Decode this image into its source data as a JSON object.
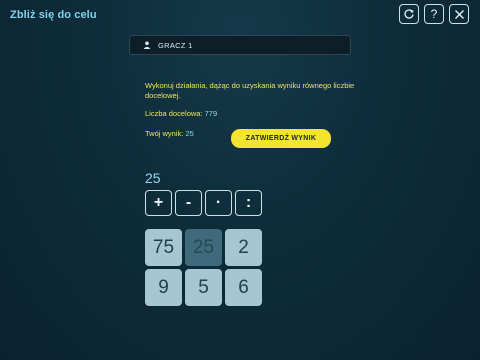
{
  "header": {
    "title": "Zbliż się do celu"
  },
  "toolbar": {
    "buttons": [
      {
        "icon": "refresh-icon"
      },
      {
        "label": "?",
        "icon": "help-icon"
      },
      {
        "icon": "close-icon"
      }
    ]
  },
  "player": {
    "name": "GRACZ 1",
    "icon": "user-icon"
  },
  "instructions": "Wykonuj działania, dążąc do uzyskania wyniku równego liczbie docelowej.",
  "target": {
    "label": "Liczba docelowa:",
    "value": "779"
  },
  "score": {
    "label": "Twój wynik:",
    "value": "25"
  },
  "submit_label": "ZATWIERDŹ WYNIK",
  "current_value": "25",
  "operators": [
    "+",
    "-",
    "·",
    ":"
  ],
  "numbers": [
    {
      "value": "75",
      "used": false
    },
    {
      "value": "25",
      "used": true
    },
    {
      "value": "2",
      "used": false
    },
    {
      "value": "9",
      "used": false
    },
    {
      "value": "5",
      "used": false
    },
    {
      "value": "6",
      "used": false
    }
  ],
  "colors": {
    "accent": "#7fd3ea",
    "highlight": "#f1e35c",
    "submit": "#f4e42f",
    "tile": "#a5c6d2",
    "tile_used": "#3f6a7b"
  }
}
